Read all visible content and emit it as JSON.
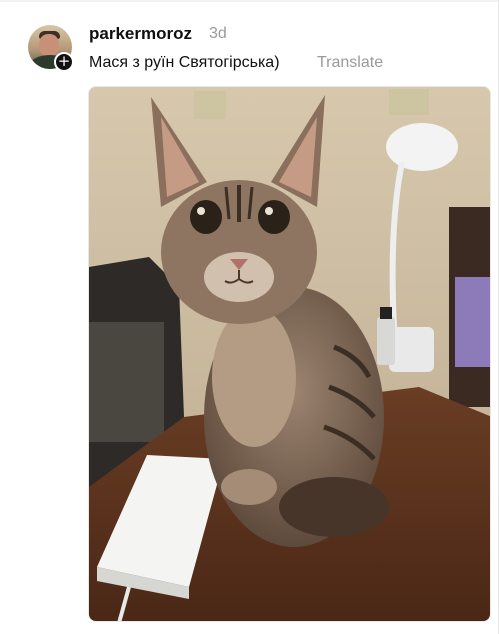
{
  "post": {
    "username": "parkermoroz",
    "time": "3d",
    "caption": "Мася з руїн Святогірська)",
    "translate_label": "Translate",
    "follow_symbol": "+"
  },
  "icons": {
    "follow": "plus-icon"
  },
  "colors": {
    "text": "#101010",
    "muted": "#9a9a9a",
    "badge": "#111111"
  }
}
